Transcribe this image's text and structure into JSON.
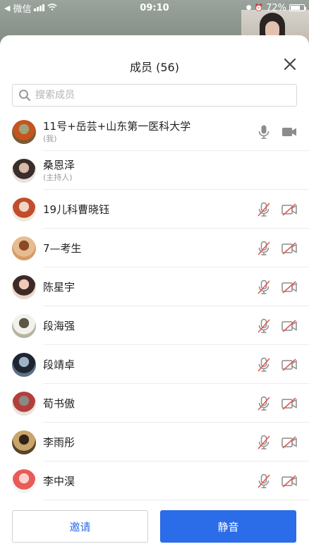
{
  "status_bar": {
    "carrier": "微信",
    "time": "09:10",
    "battery": "72%",
    "battery_level": 0.72
  },
  "panel": {
    "title": "成员 (56)",
    "close_icon": "close-icon"
  },
  "search": {
    "placeholder": "搜索成员",
    "icon": "search-icon"
  },
  "members": [
    {
      "name": "11号+岳芸+山东第一医科大学",
      "sub": "(我)",
      "mic": "mic-on",
      "cam": "camera-on",
      "avatar_colors": [
        "#7a5a34",
        "#c4551e",
        "#9fa27b"
      ]
    },
    {
      "name": "桑恩泽",
      "sub": "(主持人)",
      "mic": "",
      "cam": "",
      "avatar_colors": [
        "#e9e1dd",
        "#3a2e2a",
        "#d8b9aa"
      ]
    },
    {
      "name": "19儿科曹晓钰",
      "sub": "",
      "mic": "mic-muted",
      "cam": "camera-off",
      "avatar_colors": [
        "#f1e8dd",
        "#c24d2c",
        "#f0d7c5"
      ]
    },
    {
      "name": "7—考生",
      "sub": "",
      "mic": "mic-muted",
      "cam": "camera-off",
      "avatar_colors": [
        "#d89a64",
        "#e6bc92",
        "#8a4a26"
      ]
    },
    {
      "name": "陈星宇",
      "sub": "",
      "mic": "mic-muted",
      "cam": "camera-off",
      "avatar_colors": [
        "#e9d7cb",
        "#3b2a26",
        "#efc9b6"
      ]
    },
    {
      "name": "段海强",
      "sub": "",
      "mic": "mic-muted",
      "cam": "camera-off",
      "avatar_colors": [
        "#b8b3a0",
        "#f3f1ec",
        "#5c5845"
      ]
    },
    {
      "name": "段靖卓",
      "sub": "",
      "mic": "mic-muted",
      "cam": "camera-off",
      "avatar_colors": [
        "#5e6f86",
        "#1e2430",
        "#9fb1c7"
      ]
    },
    {
      "name": "荀书傲",
      "sub": "",
      "mic": "mic-muted",
      "cam": "camera-off",
      "avatar_colors": [
        "#e7e3df",
        "#b33f3a",
        "#8a8a86"
      ]
    },
    {
      "name": "李雨彤",
      "sub": "",
      "mic": "mic-muted",
      "cam": "camera-off",
      "avatar_colors": [
        "#5a4328",
        "#c9a46b",
        "#2f2415"
      ]
    },
    {
      "name": "李中淏",
      "sub": "",
      "mic": "mic-muted",
      "cam": "camera-off",
      "avatar_colors": [
        "#f4f4f4",
        "#e85b57",
        "#fbd2cf"
      ]
    }
  ],
  "footer": {
    "invite_label": "邀请",
    "mute_label": "静音"
  },
  "colors": {
    "accent": "#2b6de8",
    "muted_red": "#e25a55",
    "icon_gray": "#8c8c8c"
  }
}
